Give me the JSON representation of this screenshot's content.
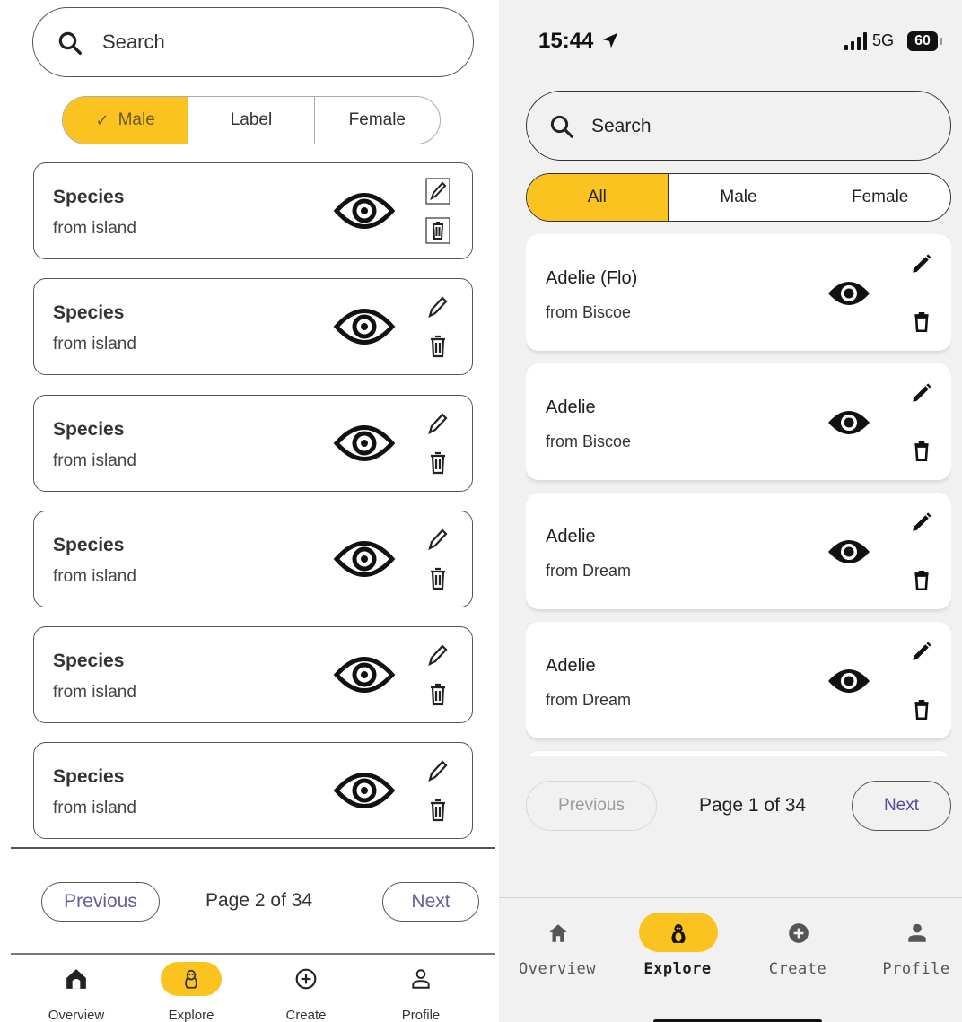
{
  "mockup": {
    "search": {
      "placeholder": "Search",
      "icon": "search-icon"
    },
    "filter": {
      "options": [
        "Male",
        "Label",
        "Female"
      ],
      "selected": "Male",
      "selected_icon": "check-icon"
    },
    "cards": [
      {
        "title": "Species",
        "subtitle": "from island"
      },
      {
        "title": "Species",
        "subtitle": "from island"
      },
      {
        "title": "Species",
        "subtitle": "from island"
      },
      {
        "title": "Species",
        "subtitle": "from island"
      },
      {
        "title": "Species",
        "subtitle": "from island"
      },
      {
        "title": "Species",
        "subtitle": "from island"
      }
    ],
    "pagination": {
      "previous": "Previous",
      "page_text": "Page 2 of 34",
      "next": "Next"
    },
    "nav": [
      {
        "label": "Overview",
        "icon": "home-icon",
        "active": false
      },
      {
        "label": "Explore",
        "icon": "penguin-icon",
        "active": true
      },
      {
        "label": "Create",
        "icon": "plus-circle-icon",
        "active": false
      },
      {
        "label": "Profile",
        "icon": "person-icon",
        "active": false
      }
    ]
  },
  "app": {
    "status_bar": {
      "time": "15:44",
      "network": "5G",
      "battery": "60"
    },
    "search": {
      "placeholder": "Search",
      "icon": "search-icon"
    },
    "filter": {
      "options": [
        "All",
        "Male",
        "Female"
      ],
      "selected": "All"
    },
    "cards": [
      {
        "title": "Adelie (Flo)",
        "subtitle": "from Biscoe"
      },
      {
        "title": "Adelie",
        "subtitle": "from Biscoe"
      },
      {
        "title": "Adelie",
        "subtitle": "from Dream"
      },
      {
        "title": "Adelie",
        "subtitle": "from Dream"
      }
    ],
    "pagination": {
      "previous": "Previous",
      "page_text": "Page 1 of 34",
      "next": "Next",
      "previous_disabled": true
    },
    "nav": [
      {
        "label": "Overview",
        "icon": "home-icon",
        "active": false
      },
      {
        "label": "Explore",
        "icon": "penguin-icon",
        "active": true
      },
      {
        "label": "Create",
        "icon": "plus-circle-icon",
        "active": false
      },
      {
        "label": "Profile",
        "icon": "person-icon",
        "active": false
      }
    ]
  },
  "colors": {
    "accent": "#fbc31f",
    "link_purple": "#6c5b9d",
    "app_background": "#f1f1f1"
  }
}
